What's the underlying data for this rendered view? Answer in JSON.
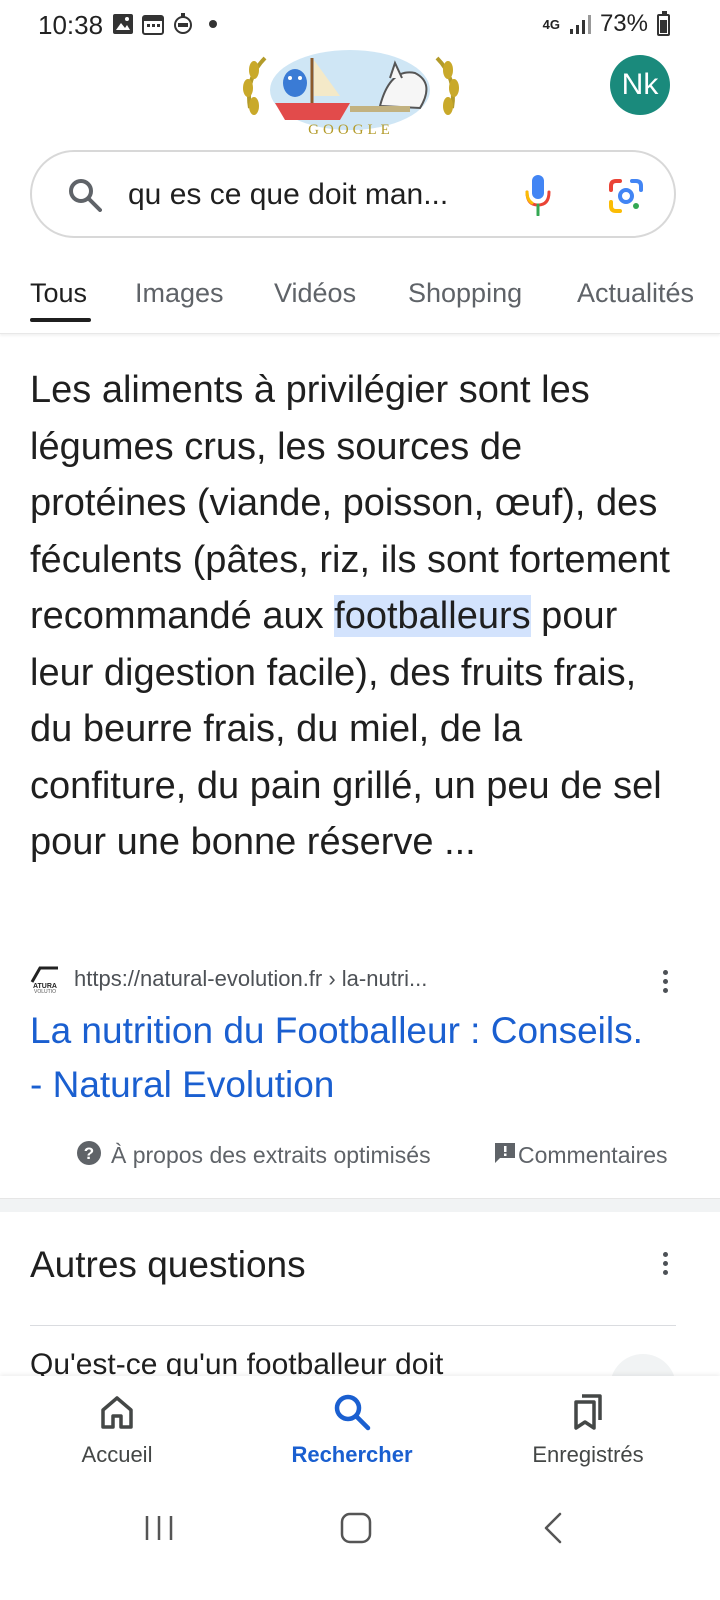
{
  "status_bar": {
    "time": "10:38",
    "network": "4G",
    "battery": "73%"
  },
  "header": {
    "doodle_text": "GOOGLE",
    "avatar_initials": "Nk",
    "avatar_color": "#1a8a7c"
  },
  "search": {
    "query": "qu es ce que doit man..."
  },
  "tabs": [
    {
      "label": "Tous",
      "active": true
    },
    {
      "label": "Images",
      "active": false
    },
    {
      "label": "Vidéos",
      "active": false
    },
    {
      "label": "Shopping",
      "active": false
    },
    {
      "label": "Actualités",
      "active": false
    }
  ],
  "snippet": {
    "text_before": "Les aliments à privilégier sont les légumes crus, les sources de protéines (viande, poisson, œuf), des féculents (pâtes, riz, ils sont fortement recommandé aux ",
    "highlight": "footballeurs",
    "text_after": " pour leur digestion facile), des fruits frais, du beurre frais, du miel, de la confiture, du pain grillé, un peu de sel pour une bonne réserve ..."
  },
  "result": {
    "url": "https://natural-evolution.fr › la-nutri...",
    "title": "La nutrition du Footballeur : Conseils. - Natural Evolution"
  },
  "snippet_footer": {
    "about": "À propos des extraits optimisés",
    "feedback": "Commentaires"
  },
  "people_also_ask": {
    "title": "Autres questions",
    "first_question": "Qu'est-ce qu'un footballeur doit"
  },
  "bottom_nav": {
    "home": "Accueil",
    "search": "Rechercher",
    "saved": "Enregistrés"
  },
  "colors": {
    "link": "#1a5fd0",
    "highlight": "#d3e3fd"
  }
}
